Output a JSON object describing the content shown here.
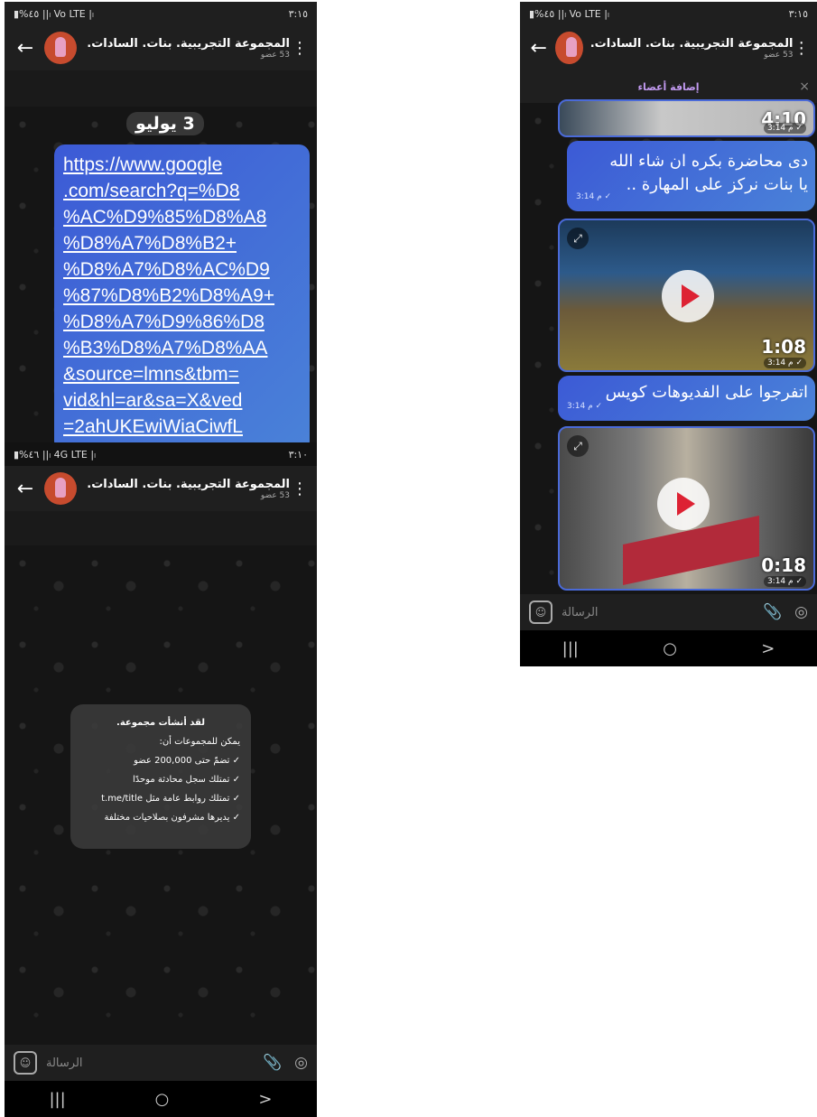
{
  "phone1": {
    "status_left": "▮%٤٥ ||ₗ Vo LTE |ₗ",
    "status_right": "٣:١٥",
    "header_title": "المجموعة التجريبية. بنات. السادات.",
    "header_members": "53 عضو",
    "date_chip": "3 يوليو",
    "link_lines": [
      "https://www.google",
      ".com/search?q=%D8",
      "%AC%D9%85%D8%A8",
      "%D8%A7%D8%B2+",
      "%D8%A7%D8%AC%D9",
      "%87%D8%B2%D8%A9+",
      "%D8%A7%D9%86%D8",
      "%B3%D8%A7%D8%AA",
      "&source=lmns&tbm=",
      "vid&hl=ar&sa=X&ved",
      "=2ahUKEwiWiaCiwfL"
    ]
  },
  "phone2": {
    "status_left": "▮%٤٦ ||ₗ 4G LTE |ₗ",
    "status_right": "٣:١٠",
    "header_title": "المجموعة التجريبية. بنات. السادات.",
    "header_members": "53 عضو",
    "card_title": "لقد أنشأت مجموعة.",
    "card_subtitle": "يمكن للمجموعات أن:",
    "card_items": [
      "✓ تضمّ حتى 200,000 عضو",
      "✓ تمتلك سجل محادثة موحدًا",
      "✓ تمتلك روابط عامة مثل t.me/title",
      "✓ يديرها مشرفون بصلاحيات مختلفة"
    ],
    "input_placeholder": "الرسالة"
  },
  "phone3": {
    "status_left": "▮%٤٥ ||ₗ Vo LTE |ₗ",
    "status_right": "٣:١٥",
    "header_title": "المجموعة التجريبية. بنات. السادات.",
    "header_members": "53 عضو",
    "add_members": "إضافة أعضاء",
    "video1_duration": "4:10",
    "video1_time": "3:14 م ✓",
    "msg1_lines": [
      "دى محاضرة بكره ان شاء الله",
      "يا بنات نركز على المهارة .."
    ],
    "msg1_time": "3:14 م ✓",
    "video2_duration": "1:08",
    "video2_time": "3:14 م ✓",
    "msg2": "اتفرجوا على الفديوهات كويس",
    "msg2_time": "3:14 م ✓",
    "video3_duration": "0:18",
    "video3_time": "3:14 م ✓",
    "input_placeholder": "الرسالة"
  },
  "nav": {
    "recents": "|||",
    "home": "○",
    "back": ">"
  }
}
